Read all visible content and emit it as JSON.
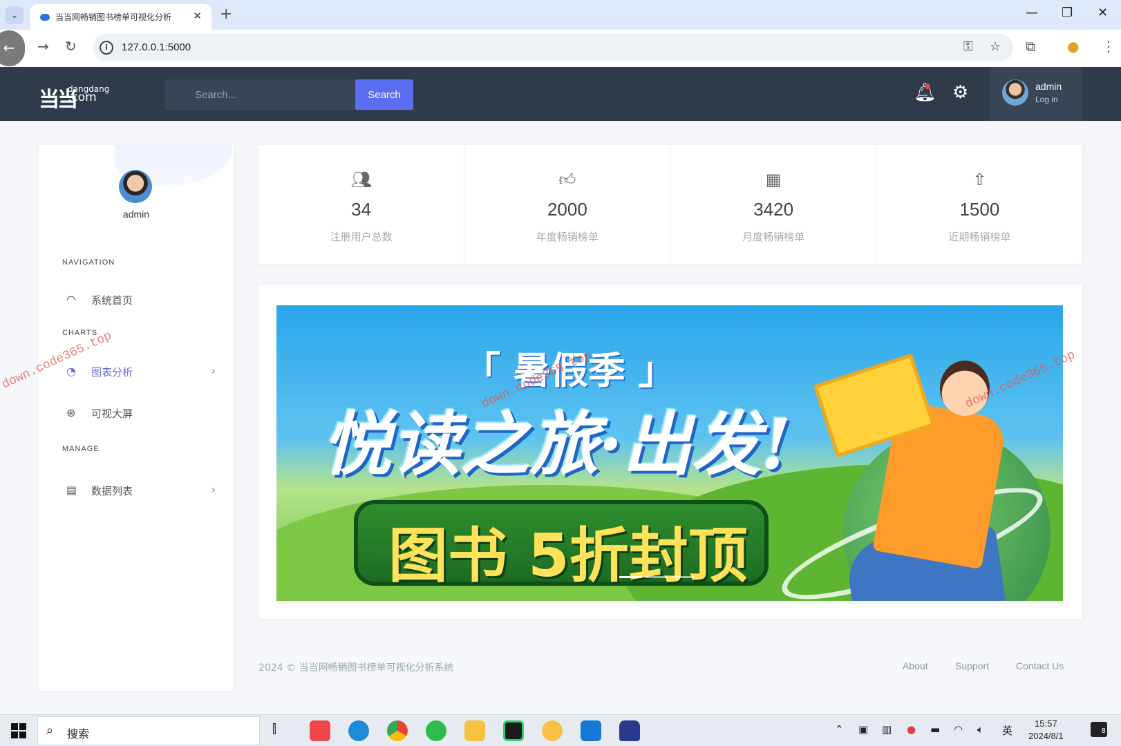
{
  "browser": {
    "tab_title": "当当网畅销图书榜单可视化分析",
    "url": "127.0.0.1:5000",
    "icons": [
      "tab-list-icon",
      "close-icon",
      "new-tab-icon",
      "minimize-icon",
      "restore-icon",
      "back-icon",
      "forward-icon",
      "reload-icon",
      "info-icon",
      "password-key-icon",
      "bookmark-star-icon",
      "extensions-icon",
      "profile-icon",
      "menu-icon"
    ]
  },
  "header": {
    "logo_mark": "当当",
    "logo_top": "dangdang",
    "logo_bottom": ".com",
    "search_placeholder": "Search...",
    "search_button": "Search",
    "user_name": "admin",
    "user_sub": "Log in",
    "colors": {
      "bar": "#303a4b",
      "accent": "#5b6df0"
    }
  },
  "sidebar": {
    "user_name": "admin",
    "sections": {
      "navigation": "NAVIGATION",
      "charts": "CHARTS",
      "manage": "MANAGE"
    },
    "items": [
      {
        "label": "系统首页",
        "icon": "dashboard-icon"
      },
      {
        "label": "图表分析",
        "icon": "pie-chart-icon",
        "expandable": true
      },
      {
        "label": "可视大屏",
        "icon": "globe-icon"
      },
      {
        "label": "数据列表",
        "icon": "list-icon",
        "expandable": true
      }
    ]
  },
  "stats": [
    {
      "value": "34",
      "label": "注册用户总数",
      "icon": "users-icon"
    },
    {
      "value": "2000",
      "label": "年度畅销榜单",
      "icon": "thumbs-up-icon"
    },
    {
      "value": "3420",
      "label": "月度畅销榜单",
      "icon": "calendar-icon"
    },
    {
      "value": "1500",
      "label": "近期畅销榜单",
      "icon": "arrow-up-icon"
    }
  ],
  "banner": {
    "season": "「 暑假季 」",
    "headline": "悦读之旅·出发!",
    "offer": "图书 5折封顶"
  },
  "watermark": "down.code365.top",
  "footer": {
    "copyright": "2024 © 当当网畅销图书榜单可视化分析系统",
    "links": [
      "About",
      "Support",
      "Contact Us"
    ]
  },
  "taskbar": {
    "search": "搜索",
    "ime": "英",
    "time": "15:57",
    "date": "2024/8/1",
    "notifications": "8"
  }
}
